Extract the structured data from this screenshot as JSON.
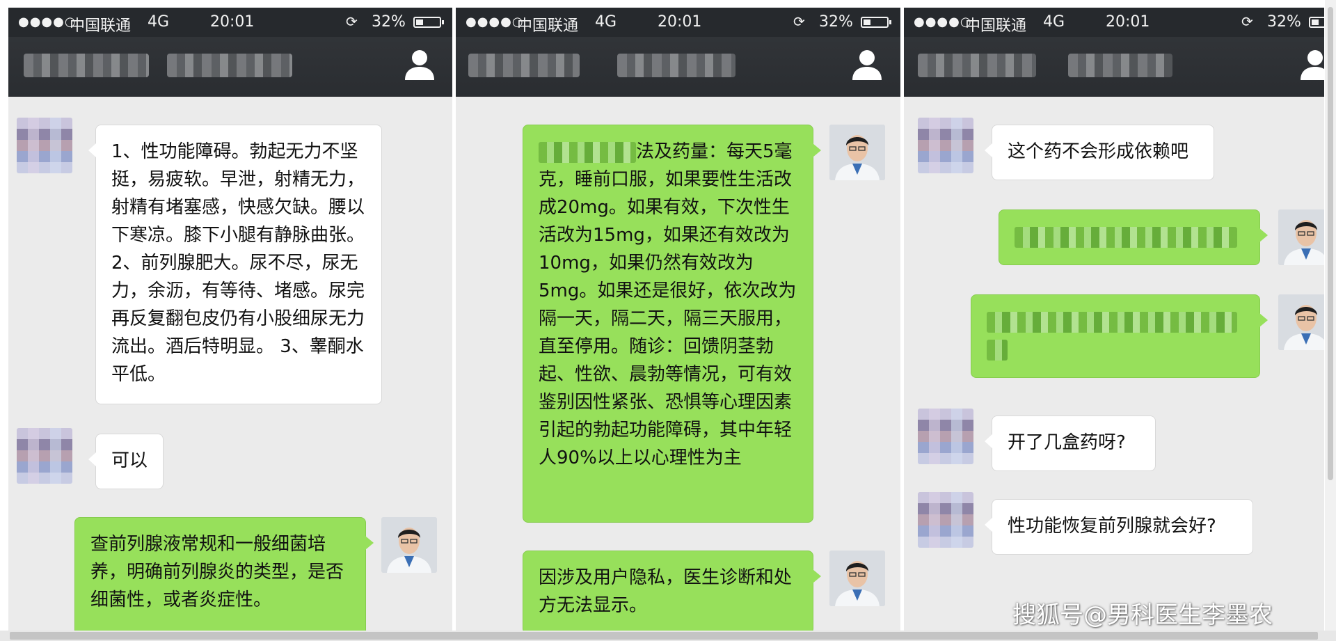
{
  "status_bar": {
    "signal": "●●●●○",
    "carrier": "中国联通",
    "network": "4G",
    "time": "20:01",
    "battery": "32%"
  },
  "panel1": {
    "messages": [
      {
        "side": "left",
        "text": "1、性功能障碍。勃起无力不坚挺，易疲软。早泄，射精无力，射精有堵塞感，快感欠缺。腰以下寒凉。膝下小腿有静脉曲张。 2、前列腺肥大。尿不尽，尿无力，余沥，有等待、堵感。尿完再反复翻包皮仍有小股细尿无力流出。酒后特明显。 3、睾酮水平低。"
      },
      {
        "side": "left",
        "text": "可以"
      },
      {
        "side": "right",
        "text": "查前列腺液常规和一般细菌培养，明确前列腺炎的类型，是否细菌性，或者炎症性。"
      }
    ]
  },
  "panel2": {
    "messages": [
      {
        "side": "right",
        "text": "法及药量：每天5毫克，睡前口服，如果要性生活改成20mg。如果有效，下次性生活改为15mg，如果还有效改为10mg，如果仍然有效改为5mg。如果还是很好，依次改为隔一天，隔二天，隔三天服用，直至停用。随诊：回馈阴茎勃起、性欲、晨勃等情况，可有效鉴别因性紧张、恐惧等心理因素引起的勃起功能障碍，其中年轻人90%以上以心理性为主"
      },
      {
        "side": "right",
        "text": "因涉及用户隐私，医生诊断和处方无法显示。"
      }
    ]
  },
  "panel3": {
    "messages": [
      {
        "side": "left",
        "text": "这个药不会形成依赖吧"
      },
      {
        "side": "right",
        "text": ""
      },
      {
        "side": "right",
        "text": ""
      },
      {
        "side": "left",
        "text": "开了几盒药呀?"
      },
      {
        "side": "left",
        "text": "性功能恢复前列腺就会好?"
      }
    ]
  },
  "watermark": "搜狐号@男科医生李墨农",
  "colors": {
    "header_bg": "#26292d",
    "chat_bg": "#ebebeb",
    "green_bubble": "#97e05b",
    "white_bubble": "#ffffff"
  }
}
